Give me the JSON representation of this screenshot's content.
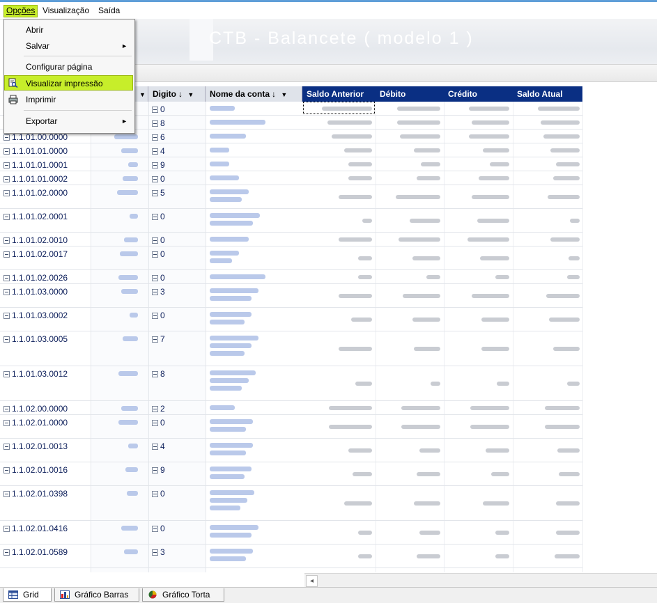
{
  "menubar": {
    "items": [
      "Opções",
      "Visualização",
      "Saída"
    ]
  },
  "banner": {
    "title": "CTB - Balancete ( modelo 1 )"
  },
  "menu": {
    "open": "Opções",
    "items": [
      {
        "label": "Abrir",
        "submenu": false
      },
      {
        "label": "Salvar",
        "submenu": true
      },
      {
        "label": "Configurar página",
        "submenu": false
      },
      {
        "label": "Visualizar impressão",
        "submenu": false,
        "highlighted": true,
        "icon": "print-preview-icon"
      },
      {
        "label": "Imprimir",
        "submenu": false,
        "icon": "printer-icon"
      },
      {
        "label": "Exportar",
        "submenu": true
      }
    ]
  },
  "grid": {
    "columns": {
      "digito": "Digito",
      "nome": "Nome da conta",
      "saldo_anterior": "Saldo Anterior",
      "debito": "Débito",
      "credito": "Crédito",
      "saldo_atual": "Saldo Atual"
    },
    "sort_arrow": "↓",
    "dropdown_arrow": "▼",
    "rows": [
      {
        "conta": "",
        "digito": "0"
      },
      {
        "conta": "",
        "digito": "8"
      },
      {
        "conta": "1.1.01.00.0000",
        "digito": "6"
      },
      {
        "conta": "1.1.01.01.0000",
        "digito": "4"
      },
      {
        "conta": "1.1.01.01.0001",
        "digito": "9"
      },
      {
        "conta": "1.1.01.01.0002",
        "digito": "0"
      },
      {
        "conta": "1.1.01.02.0000",
        "digito": "5"
      },
      {
        "conta": "1.1.01.02.0001",
        "digito": "0"
      },
      {
        "conta": "1.1.01.02.0010",
        "digito": "0"
      },
      {
        "conta": "1.1.01.02.0017",
        "digito": "0"
      },
      {
        "conta": "1.1.01.02.0026",
        "digito": "0"
      },
      {
        "conta": "1.1.01.03.0000",
        "digito": "3"
      },
      {
        "conta": "1.1.01.03.0002",
        "digito": "0"
      },
      {
        "conta": "1.1.01.03.0005",
        "digito": "7"
      },
      {
        "conta": "1.1.01.03.0012",
        "digito": "8"
      },
      {
        "conta": "1.1.02.00.0000",
        "digito": "2"
      },
      {
        "conta": "1.1.02.01.0000",
        "digito": "0"
      },
      {
        "conta": "1.1.02.01.0013",
        "digito": "4"
      },
      {
        "conta": "1.1.02.01.0016",
        "digito": "9"
      },
      {
        "conta": "1.1.02.01.0398",
        "digito": "0"
      },
      {
        "conta": "1.1.02.01.0416",
        "digito": "0"
      },
      {
        "conta": "1.1.02.01.0589",
        "digito": "3"
      }
    ]
  },
  "tabs": [
    {
      "label": "Grid",
      "icon": "grid-icon",
      "active": true
    },
    {
      "label": "Gráfico Barras",
      "icon": "bar-chart-icon",
      "active": false
    },
    {
      "label": "Gráfico Torta",
      "icon": "pie-chart-icon",
      "active": false
    }
  ],
  "colors": {
    "header_blue": "#0a2f83",
    "menu_highlight": "#c7ee2a",
    "title_bar": "#5f9ed8"
  }
}
